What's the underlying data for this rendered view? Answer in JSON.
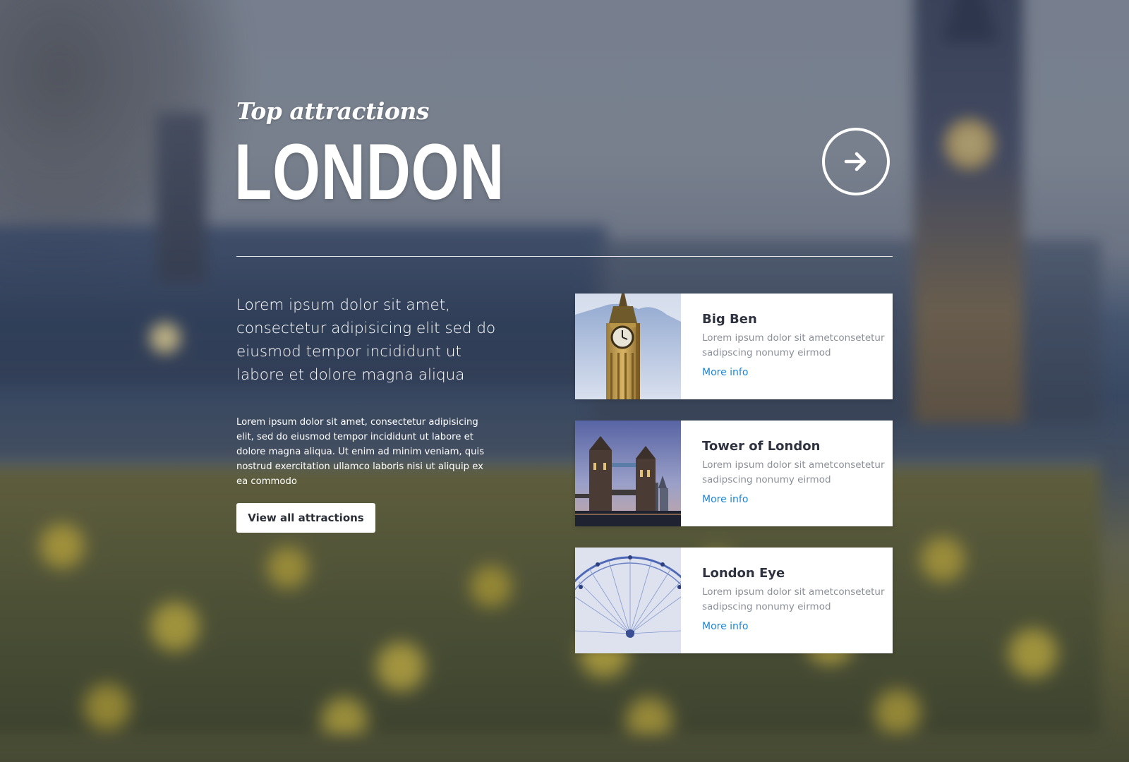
{
  "hero": {
    "eyebrow": "Top attractions",
    "title": "LONDON"
  },
  "next_button": {
    "icon": "arrow-right-icon"
  },
  "intro": {
    "lead": "Lorem ipsum dolor sit amet, consectetur adipisicing elit sed do eiusmod tempor incididunt ut labore et dolore magna aliqua",
    "body": "Lorem ipsum dolor sit amet, consectetur adipisicing elit, sed do eiusmod tempor incididunt ut labore et dolore magna aliqua. Ut enim ad minim veniam, quis nostrud exercitation ullamco laboris nisi ut aliquip ex ea commodo",
    "cta_label": "View all attractions"
  },
  "attractions": [
    {
      "name": "Big Ben",
      "description": "Lorem ipsum dolor sit ametconsetetur sadipscing nonumy eirmod",
      "link_label": "More info",
      "image": "big-ben-photo"
    },
    {
      "name": "Tower of London",
      "description": "Lorem ipsum dolor sit ametconsetetur sadipscing nonumy eirmod",
      "link_label": "More info",
      "image": "tower-bridge-photo"
    },
    {
      "name": "London Eye",
      "description": "Lorem ipsum dolor sit ametconsetetur sadipscing nonumy eirmod",
      "link_label": "More info",
      "image": "london-eye-photo"
    }
  ],
  "colors": {
    "link": "#1a86d9",
    "card_title": "#2f3340",
    "card_text": "#8b8f98",
    "button_text": "#2b2f38"
  }
}
